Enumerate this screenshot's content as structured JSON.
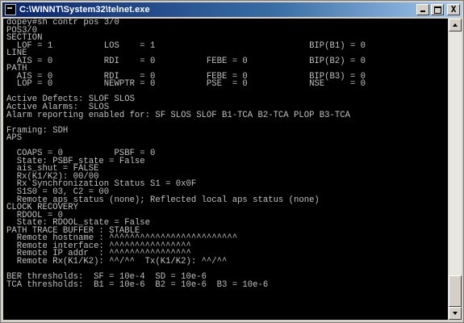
{
  "window": {
    "title": "C:\\WINNT\\System32\\telnet.exe",
    "title_icon": "console-app-icon",
    "buttons": {
      "minimize": "",
      "maximize": "",
      "close": "X"
    }
  },
  "console": {
    "lines": [
      "dopey#sh contr pos 3/0",
      "POS3/0",
      "SECTION",
      "  LOF = 1          LOS    = 1                              BIP(B1) = 0",
      "LINE",
      "  AIS = 0          RDI    = 0          FEBE = 0            BIP(B2) = 0",
      "PATH",
      "  AIS = 0          RDI    = 0          FEBE = 0            BIP(B3) = 0",
      "  LOP = 0          NEWPTR = 0          PSE  = 0            NSE     = 0",
      "",
      "Active Defects: SLOF SLOS",
      "Active Alarms:  SLOS",
      "Alarm reporting enabled for: SF SLOS SLOF B1-TCA B2-TCA PLOP B3-TCA",
      "",
      "Framing: SDH",
      "APS",
      "",
      "  COAPS = 0          PSBF = 0",
      "  State: PSBF_state = False",
      "  ais_shut = FALSE",
      "  Rx(K1/K2): 00/00",
      "  Rx Synchronization Status S1 = 0x0F",
      "  S1S0 = 03, C2 = 00",
      "  Remote aps status (none); Reflected local aps status (none)",
      "CLOCK RECOVERY",
      "  RDOOL = 0",
      "  State: RDOOL_state = False",
      "PATH TRACE BUFFER : STABLE",
      "  Remote hostname : ^^^^^^^^^^^^^^^^^^^^^^^^^",
      "  Remote interface: ^^^^^^^^^^^^^^^^",
      "  Remote IP addr  : ^^^^^^^^^^^^^^^^",
      "  Remote Rx(K1/K2): ^^/^^  Tx(K1/K2): ^^/^^",
      "",
      "BER thresholds:  SF = 10e-4  SD = 10e-6",
      "TCA thresholds:  B1 = 10e-6  B2 = 10e-6  B3 = 10e-6"
    ]
  }
}
